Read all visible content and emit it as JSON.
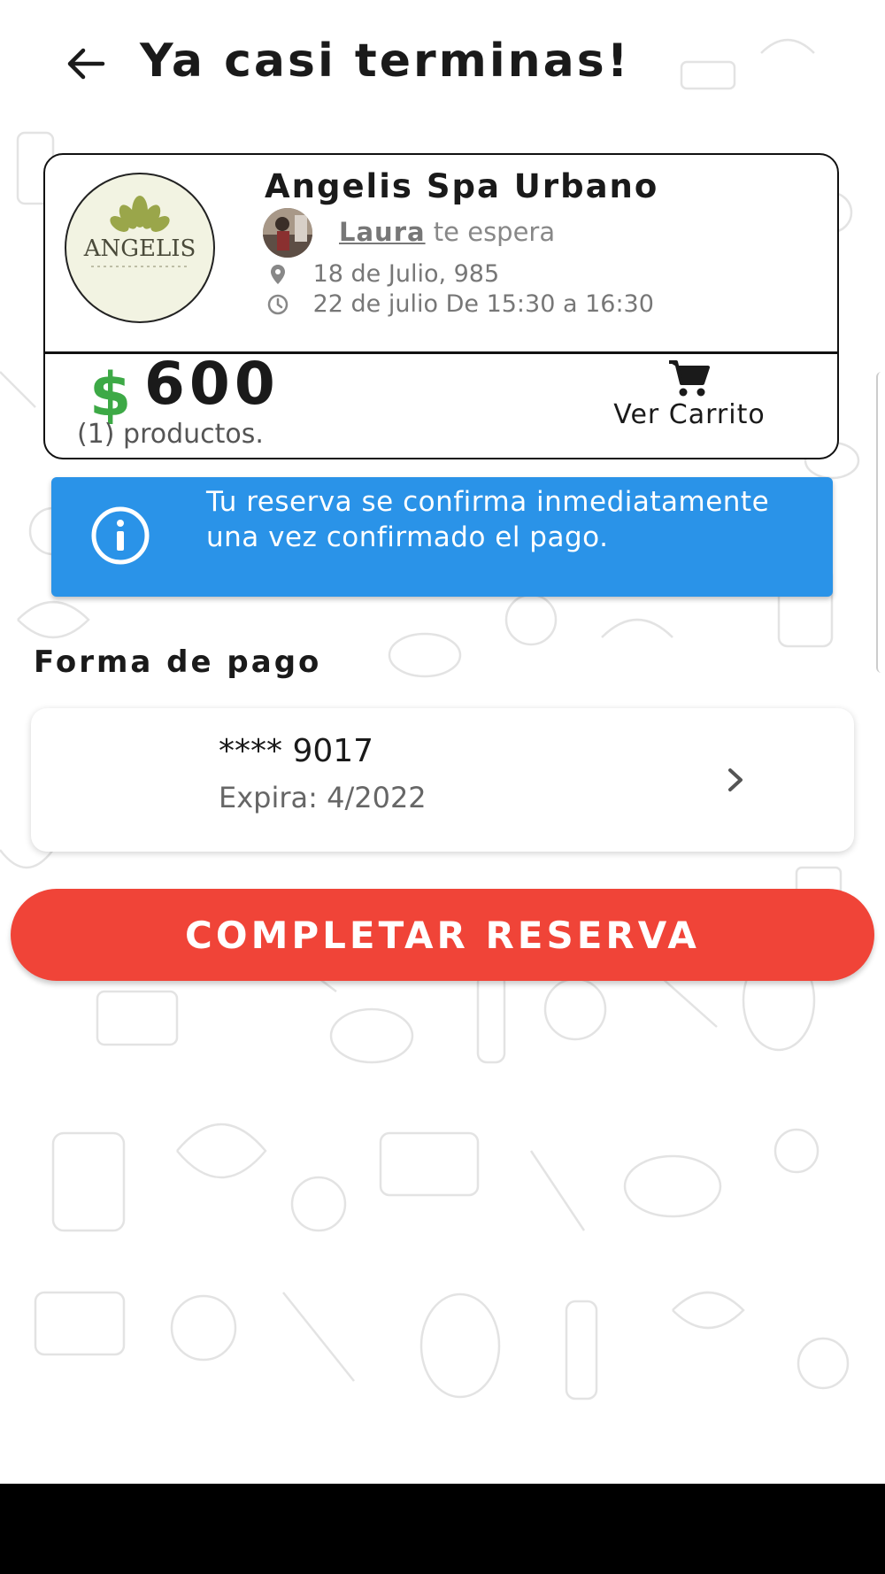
{
  "header": {
    "back_icon": "arrow-left-icon",
    "title": "Ya casi terminas!"
  },
  "summary": {
    "logo_text": "ANGELIS",
    "spa_name": "Angelis Spa Urbano",
    "staff_name": "Laura",
    "staff_suffix": "te espera",
    "address": "18 de Julio, 985",
    "schedule": "22 de julio De 15:30 a 16:30",
    "currency_symbol": "$",
    "price": "600",
    "products_count": "(1) productos.",
    "cart_label": "Ver Carrito"
  },
  "banner": {
    "text": "Tu reserva se confirma inmediatamente una vez confirmado el pago."
  },
  "payment": {
    "section_title": "Forma de pago",
    "card_number": "**** 9017",
    "expiry": "Expira: 4/2022"
  },
  "actions": {
    "complete_label": "COMPLETAR RESERVA"
  },
  "colors": {
    "accent_red": "#f04438",
    "banner_blue": "#2a93e8",
    "price_green": "#3da946"
  }
}
